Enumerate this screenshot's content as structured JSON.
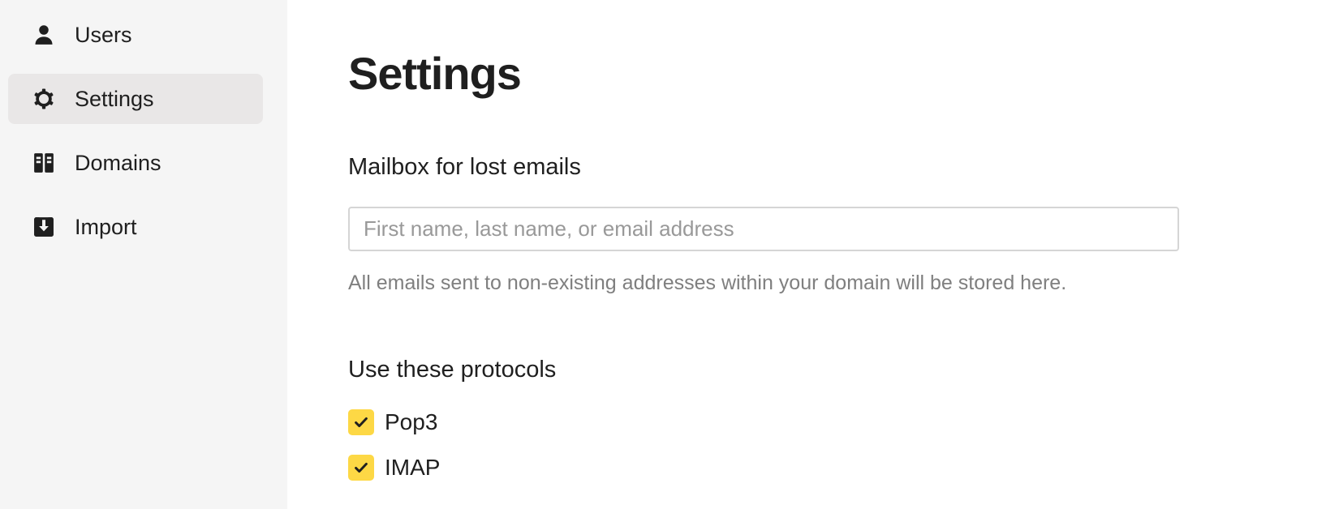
{
  "sidebar": {
    "items": [
      {
        "label": "Users",
        "icon": "user-icon",
        "active": false
      },
      {
        "label": "Settings",
        "icon": "gear-icon",
        "active": true
      },
      {
        "label": "Domains",
        "icon": "domains-icon",
        "active": false
      },
      {
        "label": "Import",
        "icon": "import-icon",
        "active": false
      }
    ]
  },
  "main": {
    "title": "Settings",
    "lost_mailbox": {
      "heading": "Mailbox for lost emails",
      "value": "",
      "placeholder": "First name, last name, or email address",
      "hint": "All emails sent to non-existing addresses within your domain will be stored here."
    },
    "protocols": {
      "heading": "Use these protocols",
      "options": [
        {
          "label": "Pop3",
          "checked": true
        },
        {
          "label": "IMAP",
          "checked": true
        }
      ]
    }
  },
  "colors": {
    "sidebar_bg": "#f5f5f5",
    "active_item_bg": "#e9e7e7",
    "checkbox_fill": "#fdd845",
    "hint_text": "#7f7f7f"
  }
}
